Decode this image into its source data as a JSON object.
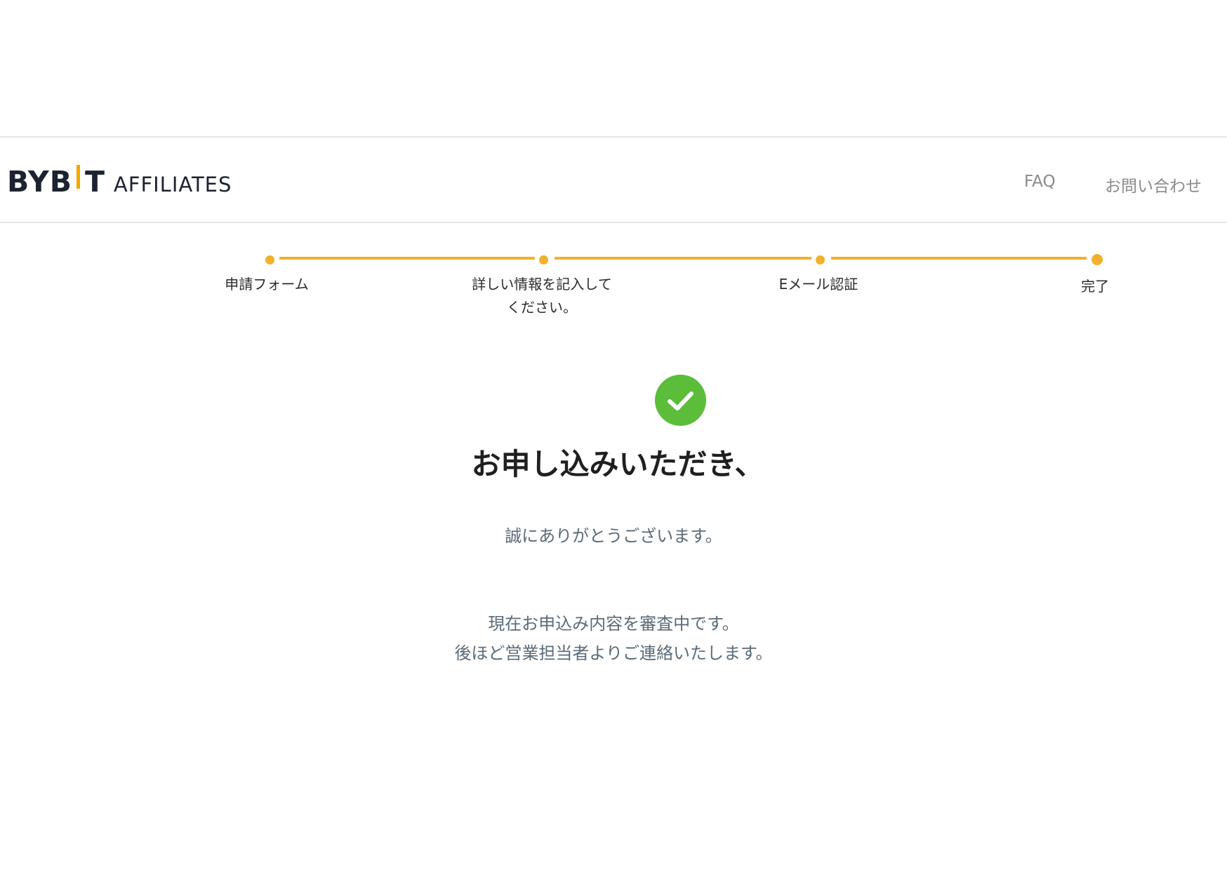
{
  "header": {
    "logo_brand": "BYBIT",
    "logo_suffix": "AFFILIATES",
    "nav": {
      "faq": "FAQ",
      "contact": "お問い合わせ"
    }
  },
  "stepper": {
    "steps": [
      {
        "label": "申請フォーム",
        "state": "completed"
      },
      {
        "label_line1": "詳しい情報を記入して",
        "label_line2": "ください。",
        "state": "completed"
      },
      {
        "label": "Eメール認証",
        "state": "completed"
      },
      {
        "label": "完了",
        "state": "current"
      }
    ],
    "accent_color": "#f2b12c"
  },
  "result": {
    "icon": "check-circle-icon",
    "icon_color": "#5bbd3a",
    "title": "お申し込みいただき、",
    "thanks": "誠にありがとうございます。",
    "status_line1": "現在お申込み内容を審査中です。",
    "status_line2": "後ほど営業担当者よりご連絡いたします。"
  }
}
